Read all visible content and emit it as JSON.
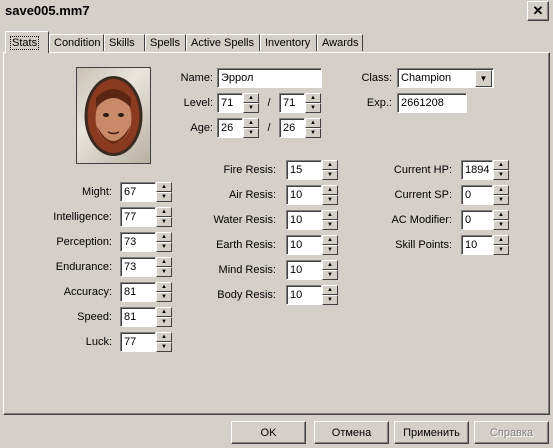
{
  "window": {
    "title": "save005.mm7",
    "close_glyph": "✕"
  },
  "tabs": [
    "Stats",
    "Condition",
    "Skills",
    "Spells",
    "Active Spells",
    "Inventory",
    "Awards"
  ],
  "active_tab": "Stats",
  "character": {
    "name_label": "Name:",
    "name": "Эррол",
    "level_label": "Level:",
    "level_current": "71",
    "level_base": "71",
    "age_label": "Age:",
    "age_current": "26",
    "age_base": "26",
    "class_label": "Class:",
    "class_value": "Champion",
    "exp_label": "Exp.:",
    "exp_value": "2661208",
    "separator": "/"
  },
  "stats": [
    {
      "label": "Might:",
      "value": "67"
    },
    {
      "label": "Intelligence:",
      "value": "77"
    },
    {
      "label": "Perception:",
      "value": "73"
    },
    {
      "label": "Endurance:",
      "value": "73"
    },
    {
      "label": "Accuracy:",
      "value": "81"
    },
    {
      "label": "Speed:",
      "value": "81"
    },
    {
      "label": "Luck:",
      "value": "77"
    }
  ],
  "resistances": [
    {
      "label": "Fire Resis:",
      "value": "15"
    },
    {
      "label": "Air Resis:",
      "value": "10"
    },
    {
      "label": "Water Resis:",
      "value": "10"
    },
    {
      "label": "Earth Resis:",
      "value": "10"
    },
    {
      "label": "Mind Resis:",
      "value": "10"
    },
    {
      "label": "Body Resis:",
      "value": "10"
    }
  ],
  "status": [
    {
      "label": "Current HP:",
      "value": "1894"
    },
    {
      "label": "Current SP:",
      "value": "0"
    },
    {
      "label": "AC Modifier:",
      "value": "0"
    },
    {
      "label": "Skill Points:",
      "value": "10"
    }
  ],
  "buttons": {
    "ok": "OK",
    "cancel": "Отмена",
    "apply": "Применить",
    "help": "Справка"
  },
  "icons": {
    "spin_up": "▲",
    "spin_down": "▼",
    "dropdown": "▼"
  }
}
